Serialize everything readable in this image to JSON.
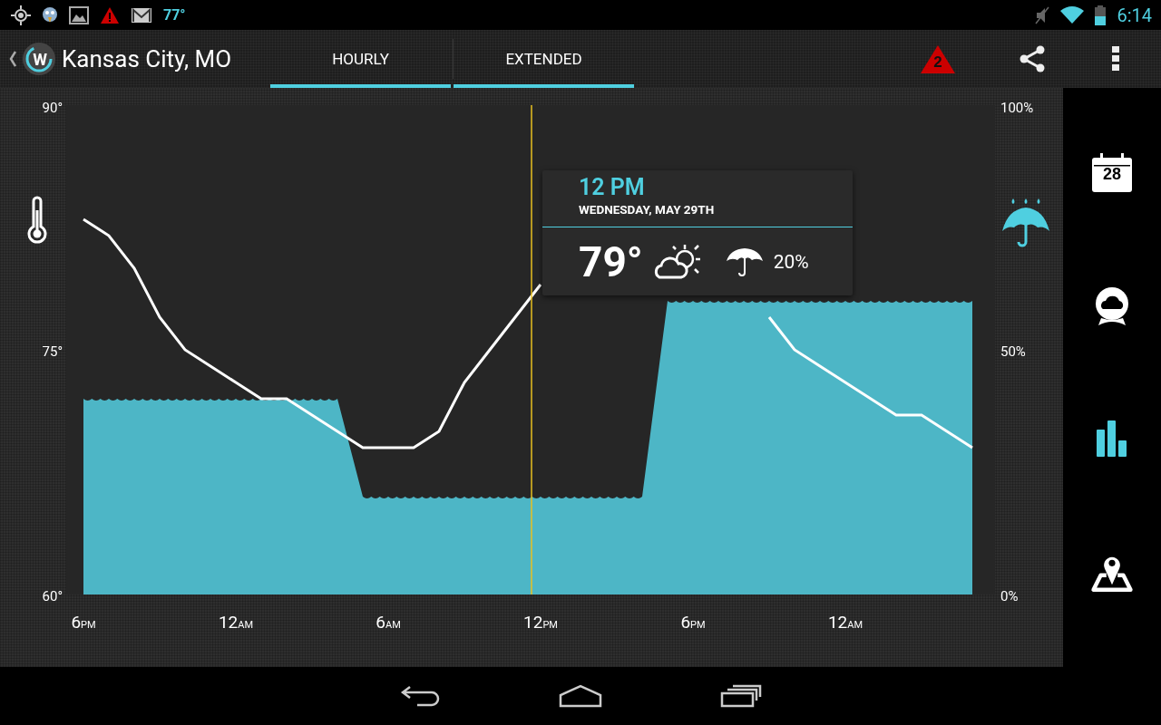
{
  "status_bar": {
    "left_text": "77°",
    "time": "6:14"
  },
  "action_bar": {
    "logo_text": "W",
    "title": "Kansas City, MO",
    "alert_count": "2"
  },
  "tabs": [
    {
      "label": "HOURLY",
      "selected": true
    },
    {
      "label": "EXTENDED",
      "selected": true
    }
  ],
  "chart": {
    "chart_data": {
      "type": "line",
      "categories": [
        "6$_{PM}$",
        null,
        null,
        null,
        null,
        null,
        "12$_{AM}$",
        null,
        null,
        null,
        null,
        null,
        "6$_{AM}$",
        null,
        null,
        null,
        null,
        null,
        "12$_{PM}$",
        null,
        null,
        null,
        null,
        null,
        "6$_{PM}$",
        null,
        null,
        null,
        null,
        null,
        "12$_{AM}$",
        null,
        null,
        null,
        null,
        null
      ],
      "series": [
        {
          "color": "#ffffff",
          "values": [
            83,
            82,
            80,
            77,
            75,
            74,
            73,
            72,
            72,
            71,
            70,
            69,
            69,
            69,
            70,
            73,
            75,
            77,
            79,
            null,
            null,
            null,
            null,
            null,
            null,
            null,
            null,
            77,
            75,
            74,
            73,
            72,
            71,
            71,
            70,
            69
          ]
        }
      ],
      "ylim": [
        60,
        90
      ],
      "yticks": [
        {
          "value": 90,
          "label": "90°"
        },
        {
          "value": 75,
          "label": "75°"
        },
        {
          "value": 60,
          "label": "60°"
        }
      ]
    },
    "precipitation": {
      "chart_data": {
        "type": "area",
        "categories": [
          null,
          null,
          null,
          null,
          null,
          null,
          null,
          null,
          null,
          null,
          null,
          null,
          null,
          null,
          null,
          null,
          null,
          null,
          null,
          null,
          null,
          null,
          null,
          null,
          null,
          null,
          null,
          null,
          null,
          null,
          null,
          null,
          null,
          null,
          null,
          null
        ],
        "series": [
          {
            "color": "#4db6c6",
            "values": [
              40,
              40,
              40,
              40,
              40,
              40,
              40,
              40,
              40,
              40,
              40,
              20,
              20,
              20,
              20,
              20,
              20,
              20,
              20,
              20,
              20,
              20,
              20,
              60,
              60,
              60,
              60,
              60,
              60,
              60,
              60,
              60,
              60,
              60,
              60,
              60
            ]
          }
        ],
        "ylim": [
          0,
          100
        ],
        "yticks": [
          {
            "value": 100,
            "label": "100%"
          },
          {
            "value": 50,
            "label": "50%"
          },
          {
            "value": 0,
            "label": "0%"
          }
        ]
      }
    }
  },
  "tooltip": {
    "time": "12 PM",
    "date": "WEDNESDAY, MAY 29TH",
    "temperature": "79°",
    "precip": "20%"
  },
  "side_nav": [
    {
      "kind": "calendar",
      "label": "28",
      "selected": false
    },
    {
      "kind": "globe",
      "selected": false
    },
    {
      "kind": "chart",
      "selected": true
    },
    {
      "kind": "map",
      "selected": false
    }
  ]
}
